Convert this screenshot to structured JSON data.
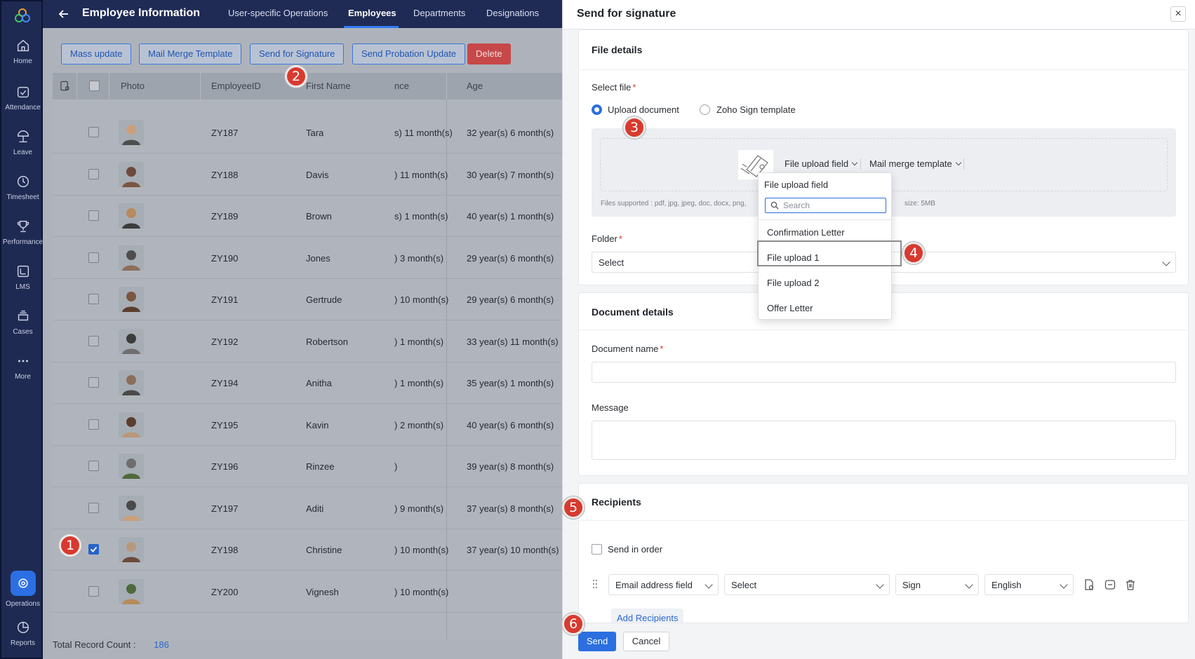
{
  "rail": {
    "items": [
      {
        "label": "Home",
        "icon": "home-icon"
      },
      {
        "label": "Attendance",
        "icon": "calendar-icon"
      },
      {
        "label": "Leave",
        "icon": "beach-umbrella-icon"
      },
      {
        "label": "Timesheet",
        "icon": "clock-icon"
      },
      {
        "label": "Performance",
        "icon": "trophy-icon"
      },
      {
        "label": "LMS",
        "icon": "book-icon"
      },
      {
        "label": "Cases",
        "icon": "cases-icon"
      },
      {
        "label": "More",
        "icon": "more-dots-icon"
      },
      {
        "label": "Operations",
        "icon": "operations-icon"
      },
      {
        "label": "Reports",
        "icon": "pie-chart-icon"
      }
    ]
  },
  "topbar": {
    "title": "Employee Information",
    "tabs": [
      "User-specific Operations",
      "Employees",
      "Departments",
      "Designations"
    ],
    "active_tab": "Employees"
  },
  "actions": {
    "mass_update": "Mass update",
    "mail_merge": "Mail Merge Template",
    "send_signature": "Send for Signature",
    "send_probation": "Send Probation Update",
    "delete": "Delete"
  },
  "grid": {
    "headers": {
      "photo": "Photo",
      "employee_id": "EmployeeID",
      "first_name": "First Name",
      "experience": "nce",
      "age": "Age"
    },
    "rows": [
      {
        "id": "ZY187",
        "name": "Tara",
        "exp": "s) 11 month(s)",
        "age": "32 year(s) 6 month(s)",
        "checked": false
      },
      {
        "id": "ZY188",
        "name": "Davis",
        "exp": ") 11 month(s)",
        "age": "30 year(s) 7 month(s)",
        "checked": false
      },
      {
        "id": "ZY189",
        "name": "Brown",
        "exp": "s) 1 month(s)",
        "age": "40 year(s) 1 month(s)",
        "checked": false
      },
      {
        "id": "ZY190",
        "name": "Jones",
        "exp": ") 3 month(s)",
        "age": "29 year(s) 6 month(s)",
        "checked": false
      },
      {
        "id": "ZY191",
        "name": "Gertrude",
        "exp": ") 10 month(s)",
        "age": "29 year(s) 6 month(s)",
        "checked": false
      },
      {
        "id": "ZY192",
        "name": "Robertson",
        "exp": ") 1 month(s)",
        "age": "33 year(s) 11 month(s)",
        "checked": false
      },
      {
        "id": "ZY194",
        "name": "Anitha",
        "exp": ") 1 month(s)",
        "age": "35 year(s) 1 month(s)",
        "checked": false
      },
      {
        "id": "ZY195",
        "name": "Kavin",
        "exp": ") 2 month(s)",
        "age": "40 year(s) 6 month(s)",
        "checked": false
      },
      {
        "id": "ZY196",
        "name": "Rinzee",
        "exp": ")",
        "age": "39 year(s) 8 month(s)",
        "checked": false
      },
      {
        "id": "ZY197",
        "name": "Aditi",
        "exp": ") 9 month(s)",
        "age": "37 year(s) 8 month(s)",
        "checked": false
      },
      {
        "id": "ZY198",
        "name": "Christine",
        "exp": ") 10 month(s)",
        "age": "37 year(s) 10 month(s)",
        "checked": true
      },
      {
        "id": "ZY200",
        "name": "Vignesh",
        "exp": ") 10 month(s)",
        "age": "",
        "checked": false
      }
    ],
    "total_label": "Total Record Count :",
    "total_value": "186"
  },
  "badges": [
    "1",
    "2",
    "3",
    "4",
    "5",
    "6"
  ],
  "panel": {
    "title": "Send for signature",
    "file_details": {
      "title": "File details",
      "select_file_label": "Select file",
      "option_upload": "Upload document",
      "option_template": "Zoho Sign template",
      "file_upload_field": "File upload field",
      "mail_merge_template": "Mail merge template",
      "files_supported": "Files supported : pdf, jpg, jpeg, doc, docx, png,",
      "max_size": "size: 5MB",
      "folder_label": "Folder",
      "folder_value": "Select"
    },
    "dropdown": {
      "title": "File upload field",
      "search_placeholder": "Search",
      "items": [
        "Confirmation Letter",
        "File upload 1",
        "File upload 2",
        "Offer Letter"
      ],
      "highlighted": "File upload 1"
    },
    "document_details": {
      "title": "Document details",
      "name_label": "Document name",
      "message_label": "Message"
    },
    "recipients": {
      "title": "Recipients",
      "send_in_order": "Send in order",
      "field_type": "Email address field",
      "field_value": "Select",
      "action": "Sign",
      "language": "English",
      "add_recipients": "Add Recipients"
    },
    "send": "Send",
    "cancel": "Cancel"
  },
  "colors": {
    "primary": "#2b6fe0",
    "danger": "#c74848",
    "badge": "#d83a2f",
    "nav": "#1f2b55"
  }
}
